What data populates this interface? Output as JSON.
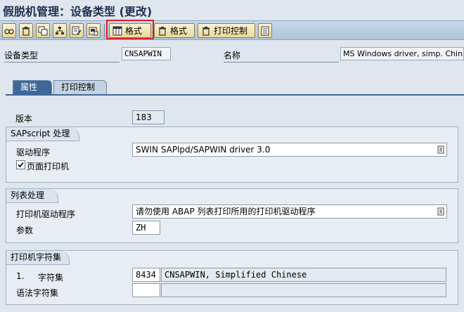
{
  "window": {
    "title": "假脱机管理：设备类型 (更改)"
  },
  "toolbar": {
    "format_selected_label": "格式",
    "format_delete_label": "格式",
    "print_control_label": "打印控制"
  },
  "header": {
    "device_type_label": "设备类型",
    "device_type_value": "CNSAPWIN",
    "name_label": "名称",
    "name_value": "MS Windows driver, simp. Chin."
  },
  "tabs": [
    {
      "label": "属性",
      "active": true
    },
    {
      "label": "打印控制",
      "active": false
    }
  ],
  "attributes": {
    "version_label": "版本",
    "version_value": "183",
    "sapscript": {
      "title": "SAPscript 处理",
      "driver_label": "驱动程序",
      "driver_value": "SWIN SAPlpd/SAPWIN driver 3.0",
      "page_printer_label": "页面打印机",
      "page_printer_checked": true
    },
    "list_processing": {
      "title": "列表处理",
      "printer_driver_label": "打印机驱动程序",
      "printer_driver_value": "请勿使用 ABAP 列表打印所用的打印机驱动程序",
      "param_label": "参数",
      "param_value": "ZH"
    },
    "charset": {
      "title": "打印机字符集",
      "row1_num": "1.",
      "row1_label": "字符集",
      "row1_code": "8434",
      "row1_desc": "CNSAPWIN, Simplified Chinese",
      "row2_label": "语法字符集",
      "row2_code": "",
      "row2_desc": ""
    }
  },
  "colors": {
    "accent": "#3f6899",
    "highlight": "#e0202c",
    "background": "#dfe6ee"
  }
}
